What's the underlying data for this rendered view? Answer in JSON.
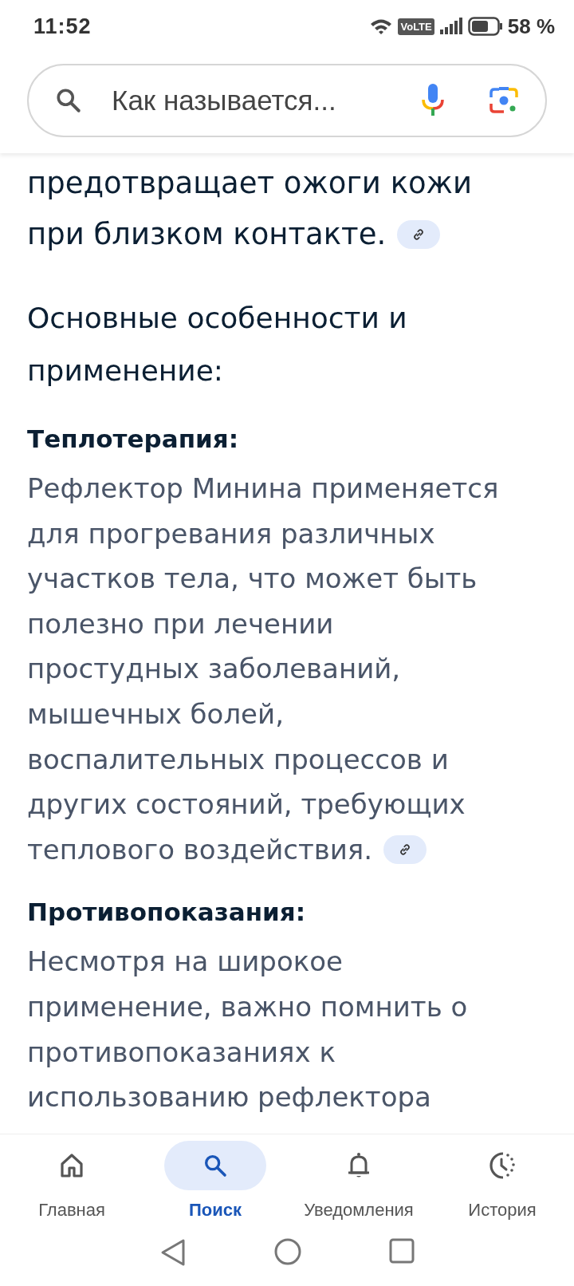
{
  "status_bar": {
    "time": "11:52",
    "network_badge": "VoLTE",
    "battery": "58 %"
  },
  "search": {
    "query": "Как называется..."
  },
  "content": [
    {
      "kind": "paragraph",
      "lines": [
        "предотвращает ожоги кожи",
        "при близком контакте."
      ],
      "source_link": true
    },
    {
      "kind": "heading",
      "lines": [
        "Основные особенности и",
        "применение:"
      ]
    },
    {
      "kind": "subheading",
      "lines": [
        "Теплотерапия:"
      ]
    },
    {
      "kind": "body",
      "lines": [
        "Рефлектор Минина применяется",
        "для прогревания различных",
        "участков тела, что может быть",
        "полезно при лечении",
        "простудных заболеваний,",
        "мышечных болей,",
        "воспалительных процессов и",
        "других состояний, требующих",
        "теплового воздействия."
      ],
      "source_link": true
    },
    {
      "kind": "subheading",
      "lines": [
        "Противопоказания:"
      ]
    },
    {
      "kind": "body",
      "lines": [
        "Несмотря на широкое",
        "применение, важно помнить о",
        "противопоказаниях к",
        "использованию рефлектора"
      ]
    }
  ],
  "nav": [
    {
      "kind": "home",
      "label": "Главная",
      "selected": false
    },
    {
      "kind": "search",
      "label": "Поиск",
      "selected": true
    },
    {
      "kind": "bell",
      "label": "Уведомления",
      "selected": false
    },
    {
      "kind": "history",
      "label": "История",
      "selected": false
    }
  ]
}
